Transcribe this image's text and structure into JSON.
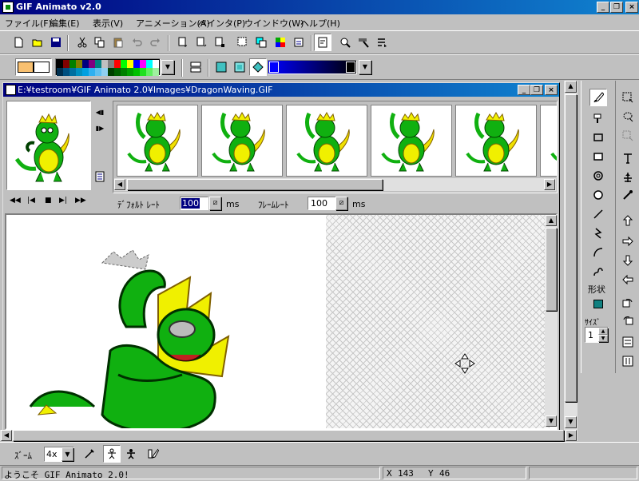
{
  "window": {
    "title": "GIF Animato v2.0",
    "controls": {
      "minimize": "_",
      "restore": "❐",
      "close": "×"
    }
  },
  "menu": [
    "ファイル(F)",
    "編集(E)",
    "表示(V)",
    "アニメーション(A)",
    "ペインタ(P)",
    "ウインドウ(W)",
    "ヘルプ(H)"
  ],
  "colors": {
    "foreground": "#f8c070",
    "background": "#ffffff",
    "gradient_start": "#0000ff",
    "gradient_end": "#000000",
    "shape_swatch": "#108080"
  },
  "palette": [
    "#000000",
    "#800000",
    "#008000",
    "#808000",
    "#000080",
    "#800080",
    "#008080",
    "#c0c0c0",
    "#808080",
    "#ff0000",
    "#00ff00",
    "#ffff00",
    "#0000ff",
    "#ff00ff",
    "#00ffff",
    "#ffffff",
    "#003050",
    "#005080",
    "#0070a0",
    "#0090c0",
    "#00a0e0",
    "#30b0f0",
    "#60c0f0",
    "#90d0f0",
    "#004000",
    "#006000",
    "#008000",
    "#00a000",
    "#00c000",
    "#20e020",
    "#60f060",
    "#a0f0a0"
  ],
  "document": {
    "title": "E:¥testroom¥GIF Animato 2.0¥Images¥DragonWaving.GIF"
  },
  "frame_settings": {
    "default_rate_label": "ﾃﾞﾌｫﾙﾄ ﾚｰﾄ",
    "default_rate_value": "100",
    "frame_rate_label": "ﾌﾚｰﾑﾚｰﾄ",
    "frame_rate_value": "100",
    "unit": "ms"
  },
  "playback": {
    "first": "◀◀",
    "prev": "|◀",
    "stop": "■",
    "next": "▶|",
    "last": "▶▶"
  },
  "right_panel": {
    "shape_label": "形状",
    "size_label": "ｻｲｽﾞ",
    "size_value": "1"
  },
  "bottom_toolbar": {
    "zoom_label": "ｽﾞｰﾑ",
    "zoom_value": "4x"
  },
  "status": {
    "message": "ようこそ GIF Animato 2.0!",
    "x_label": "X",
    "x_value": "143",
    "y_label": "Y",
    "y_value": "46"
  },
  "icons": [
    "new-icon",
    "open-icon",
    "save-icon",
    "cut-icon",
    "copy-icon",
    "paste-icon",
    "undo-icon",
    "redo-icon",
    "brush-icon",
    "fill-icon",
    "rectangle-icon",
    "ellipse-icon",
    "line-icon",
    "curve-icon",
    "text-icon",
    "select-icon"
  ]
}
